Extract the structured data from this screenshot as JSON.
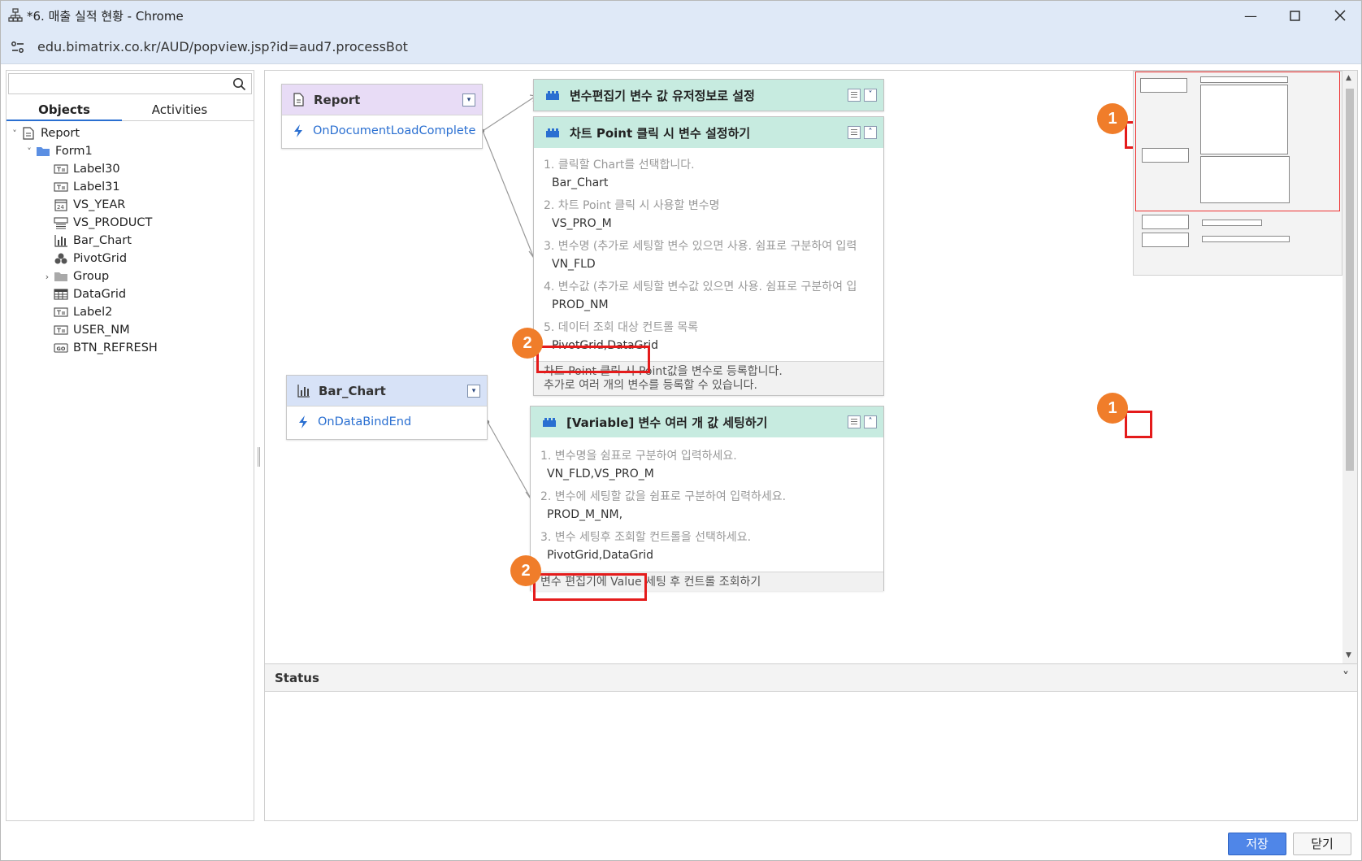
{
  "window": {
    "title": "*6. 매출 실적 현황 - Chrome",
    "url": "edu.bimatrix.co.kr/AUD/popview.jsp?id=aud7.processBot"
  },
  "left_panel": {
    "search_placeholder": "",
    "tabs": [
      {
        "label": "Objects",
        "active": true
      },
      {
        "label": "Activities",
        "active": false
      }
    ],
    "tree": [
      {
        "label": "Report",
        "level": 0,
        "toggle": "expanded",
        "icon": "report-icon"
      },
      {
        "label": "Form1",
        "level": 1,
        "toggle": "expanded",
        "icon": "folder-icon"
      },
      {
        "label": "Label30",
        "level": 2,
        "toggle": "none",
        "icon": "label-icon"
      },
      {
        "label": "Label31",
        "level": 2,
        "toggle": "none",
        "icon": "label-icon"
      },
      {
        "label": "VS_YEAR",
        "level": 2,
        "toggle": "none",
        "icon": "calendar-icon"
      },
      {
        "label": "VS_PRODUCT",
        "level": 2,
        "toggle": "none",
        "icon": "combo-icon"
      },
      {
        "label": "Bar_Chart",
        "level": 2,
        "toggle": "none",
        "icon": "bar-chart-icon"
      },
      {
        "label": "PivotGrid",
        "level": 2,
        "toggle": "none",
        "icon": "pivot-icon"
      },
      {
        "label": "Group",
        "level": 2,
        "toggle": "collapsed",
        "icon": "group-folder-icon"
      },
      {
        "label": "DataGrid",
        "level": 2,
        "toggle": "none",
        "icon": "grid-icon"
      },
      {
        "label": "Label2",
        "level": 2,
        "toggle": "none",
        "icon": "label-icon"
      },
      {
        "label": "USER_NM",
        "level": 2,
        "toggle": "none",
        "icon": "label-icon"
      },
      {
        "label": "BTN_REFRESH",
        "level": 2,
        "toggle": "none",
        "icon": "button-icon"
      }
    ]
  },
  "canvas": {
    "nodes": [
      {
        "id": "report",
        "title": "Report",
        "event": "OnDocumentLoadComplete",
        "header_color": "#e8dcf6"
      },
      {
        "id": "bar_chart",
        "title": "Bar_Chart",
        "event": "OnDataBindEnd",
        "header_color": "#d7e2f7"
      }
    ],
    "activities": [
      {
        "id": "act1",
        "title": "변수편집기 변수 값 유저정보로 설정",
        "collapsed": true
      },
      {
        "id": "act2",
        "title": "차트 Point 클릭 시 변수 설정하기",
        "params": [
          {
            "label": "1. 클릭할 Chart를 선택합니다.",
            "value": "Bar_Chart"
          },
          {
            "label": "2. 차트 Point 클릭 시 사용할 변수명",
            "value": "VS_PRO_M"
          },
          {
            "label": "3. 변수명 (추가로 세팅할 변수 있으면 사용. 쉼표로 구분하여 입력",
            "value": "VN_FLD"
          },
          {
            "label": "4. 변수값 (추가로 세팅할 변수값 있으면 사용. 쉼표로 구분하여 입",
            "value": "PROD_NM"
          },
          {
            "label": "5. 데이터 조회 대상 컨트롤 목록",
            "value": "PivotGrid,DataGrid"
          }
        ],
        "footer": [
          "차트 Point 클릭 시 Point값을 변수로 등록합니다.",
          "추가로  여러 개의 변수를 등록할 수 있습니다."
        ]
      },
      {
        "id": "act3",
        "title": "[Variable] 변수 여러 개 값 세팅하기",
        "params": [
          {
            "label": "1. 변수명을 쉼표로 구분하여 입력하세요.",
            "value": "VN_FLD,VS_PRO_M"
          },
          {
            "label": "2. 변수에 세팅할 값을 쉼표로 구분하여 입력하세요.",
            "value": "PROD_M_NM,"
          },
          {
            "label": "3. 변수 세팅후 조회할 컨트롤을 선택하세요.",
            "value": "PivotGrid,DataGrid"
          }
        ],
        "footer": [
          "변수 편집기에 Value 세팅 후 컨트롤 조회하기"
        ]
      }
    ],
    "badges": [
      "1",
      "2",
      "1",
      "2"
    ]
  },
  "status": {
    "title": "Status"
  },
  "buttons": {
    "save": "저장",
    "close": "닫기"
  },
  "colors": {
    "titlebar": "#dfe9f7",
    "activity_header": "#c7ebe0",
    "highlight": "#e41b1b",
    "badge": "#f07d2a",
    "primary_button": "#4f86e8",
    "link": "#2a6fd1"
  }
}
